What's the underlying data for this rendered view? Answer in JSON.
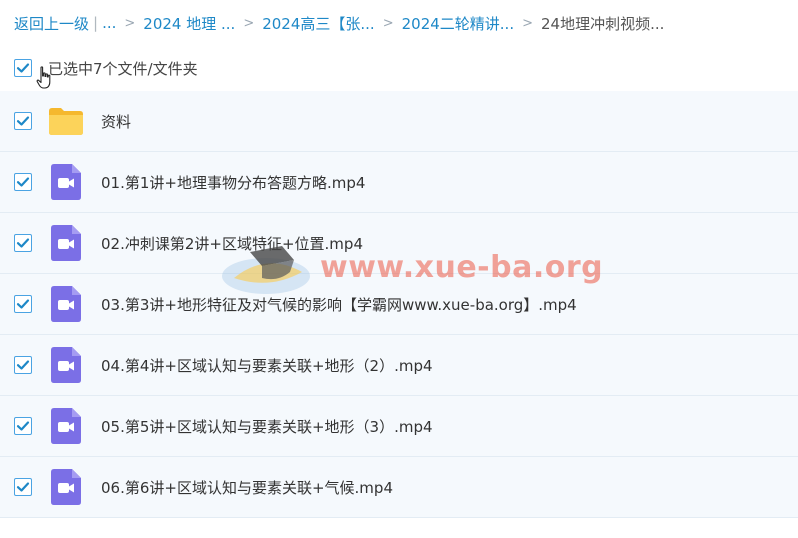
{
  "breadcrumb": {
    "back": "返回上一级",
    "ellipsis": "...",
    "items": [
      "2024 地理 ...",
      "2024高三【张...",
      "2024二轮精讲...",
      "24地理冲刺视频..."
    ]
  },
  "selection": {
    "text": "已选中7个文件/文件夹"
  },
  "files": [
    {
      "name": "资料",
      "type": "folder"
    },
    {
      "name": "01.第1讲+地理事物分布答题方略.mp4",
      "type": "video"
    },
    {
      "name": "02.冲刺课第2讲+区域特征+位置.mp4",
      "type": "video"
    },
    {
      "name": "03.第3讲+地形特征及对气候的影响【学霸网www.xue-ba.org】.mp4",
      "type": "video"
    },
    {
      "name": "04.第4讲+区域认知与要素关联+地形（2）.mp4",
      "type": "video"
    },
    {
      "name": "05.第5讲+区域认知与要素关联+地形（3）.mp4",
      "type": "video"
    },
    {
      "name": "06.第6讲+区域认知与要素关联+气候.mp4",
      "type": "video"
    }
  ],
  "watermark": {
    "text": "www.xue-ba.org"
  },
  "colors": {
    "link": "#1e88c7",
    "checkbox": "#1e88c7",
    "folder": "#fcc94a",
    "video": "#7b6fe6",
    "rowBg": "#f5f9fd"
  },
  "icons": {
    "folder": "folder-icon",
    "video": "video-file-icon",
    "check": "checkmark-icon",
    "cursor": "hand-cursor-icon"
  }
}
